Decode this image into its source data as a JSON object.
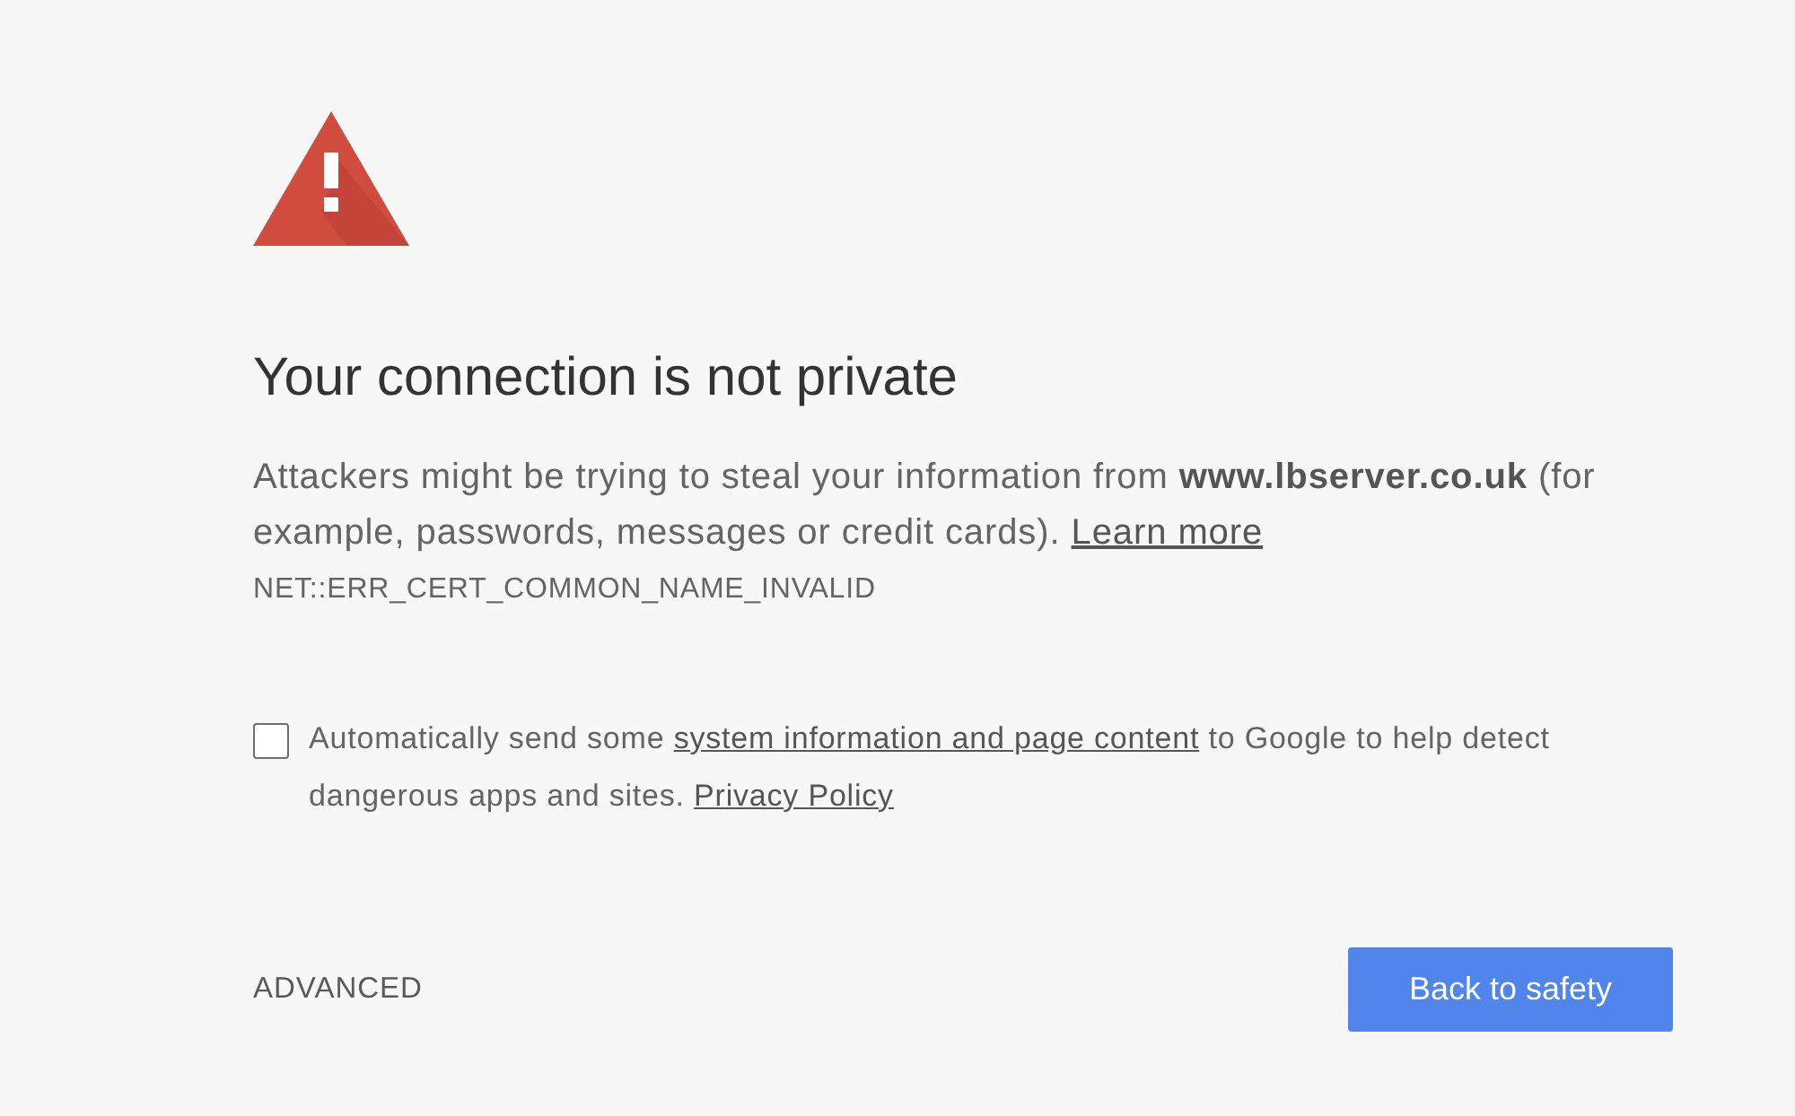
{
  "heading": "Your connection is not private",
  "explanation": {
    "text": "Attackers might be trying to steal your information from **www.lbserver.co.uk** (for example, passwords, messages or credit cards).",
    "link": "Learn more"
  },
  "error_code": "NET::ERR_CERT_COMMON_NAME_INVALID",
  "report_option": {
    "checked": false,
    "parts": [
      {
        "kind": "text",
        "text": "Automatically send some"
      },
      {
        "kind": "link",
        "text": "system information and page content"
      },
      {
        "kind": "text",
        "text": "to Google to help detect dangerous apps and sites."
      },
      {
        "kind": "link",
        "text": "Privacy Policy"
      }
    ]
  },
  "advanced_button": "ADVANCED",
  "primary_button": "Back to safety"
}
